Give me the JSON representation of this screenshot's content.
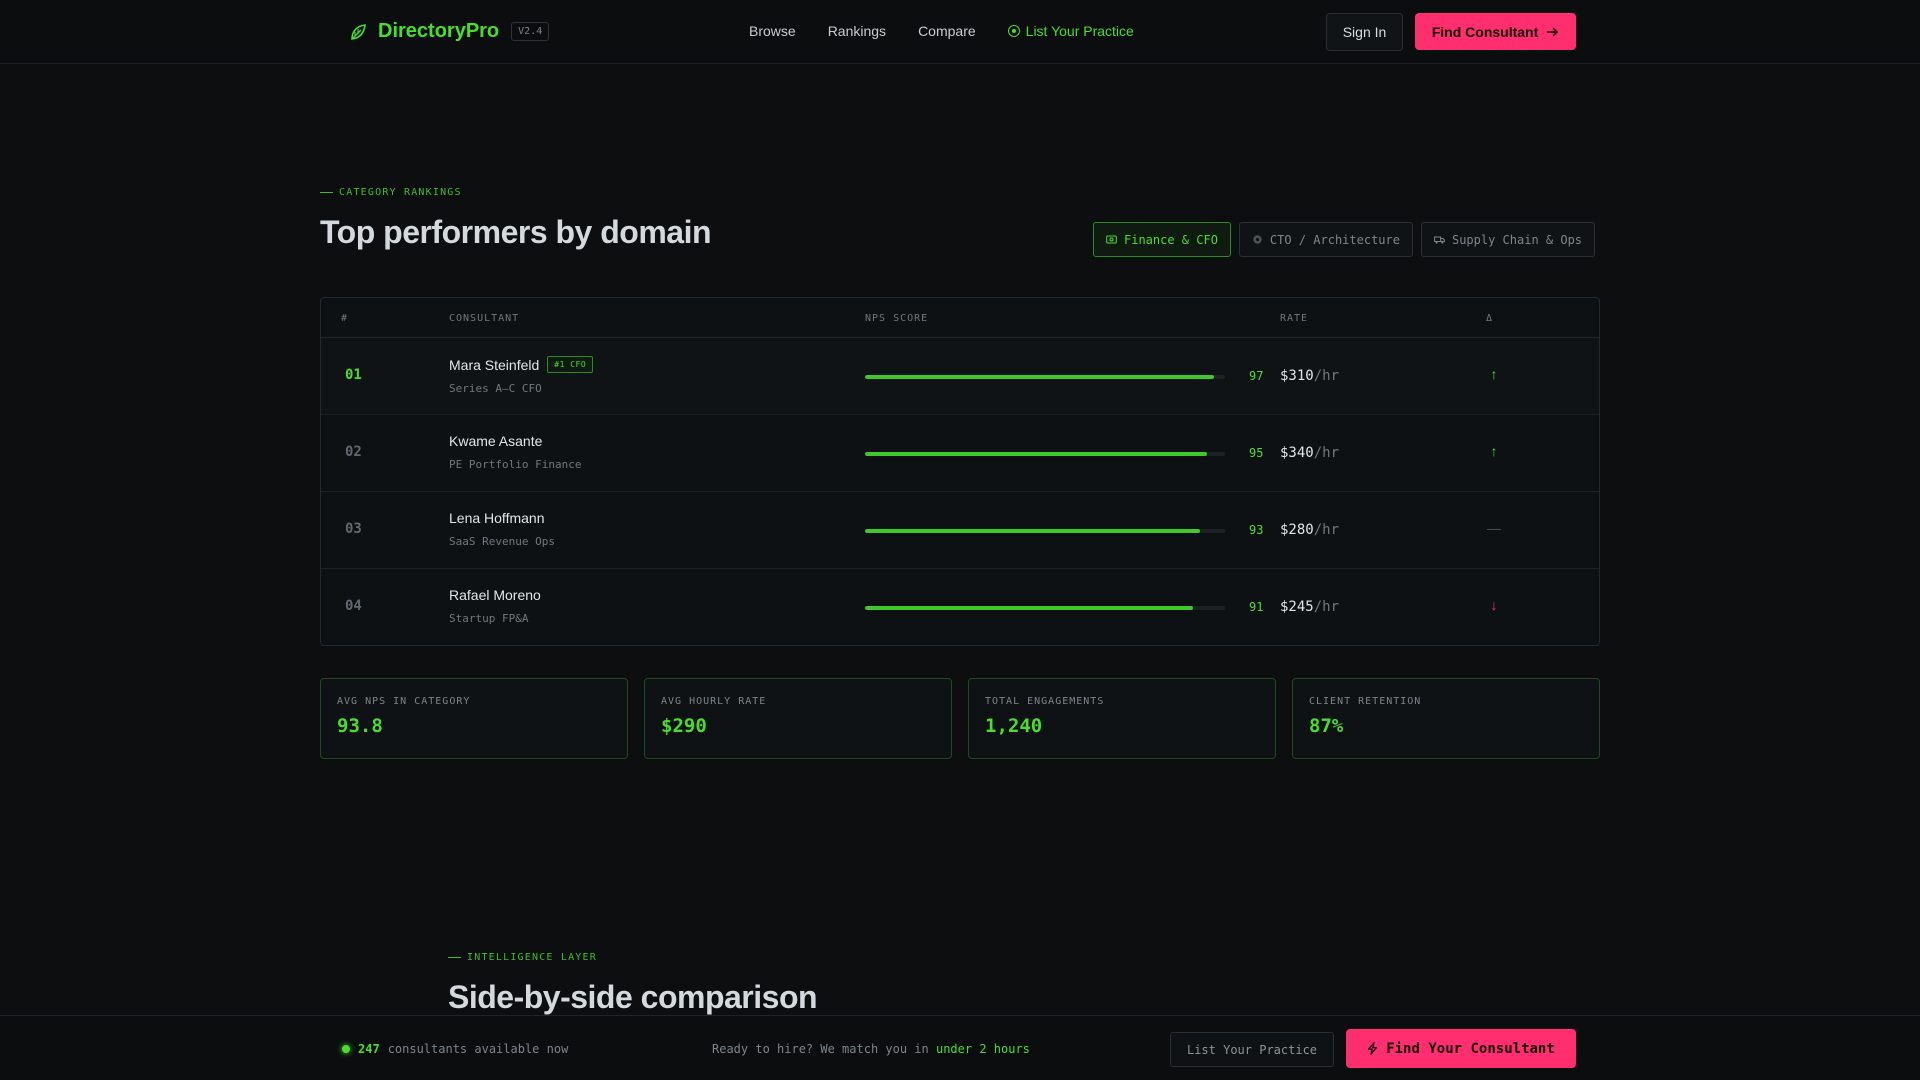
{
  "header": {
    "brand": "DirectoryPro",
    "version": "V2.4",
    "nav": [
      "Browse",
      "Rankings",
      "Compare"
    ],
    "nav_cta": "List Your Practice",
    "sign_in": "Sign In",
    "find_consultant": "Find Consultant"
  },
  "rankings": {
    "eyebrow": "CATEGORY RANKINGS",
    "title": "Top performers by domain",
    "filters": [
      {
        "label": "Finance & CFO",
        "active": true,
        "icon": "card-icon"
      },
      {
        "label": "CTO / Architecture",
        "active": false,
        "icon": "gear-icon"
      },
      {
        "label": "Supply Chain & Ops",
        "active": false,
        "icon": "truck-icon"
      }
    ],
    "columns": {
      "rank": "#",
      "consultant": "CONSULTANT",
      "nps": "NPS SCORE",
      "rate": "RATE",
      "delta": "Δ"
    },
    "rows": [
      {
        "rank": "01",
        "name": "Mara Steinfeld",
        "badge": "#1 CFO",
        "subtitle": "Series A–C CFO",
        "nps": 97,
        "nps_label": "97",
        "rate": "$310",
        "rate_unit": "/hr",
        "trend": "up",
        "trend_glyph": "↑"
      },
      {
        "rank": "02",
        "name": "Kwame Asante",
        "badge": "",
        "subtitle": "PE Portfolio Finance",
        "nps": 95,
        "nps_label": "95",
        "rate": "$340",
        "rate_unit": "/hr",
        "trend": "up",
        "trend_glyph": "↑"
      },
      {
        "rank": "03",
        "name": "Lena Hoffmann",
        "badge": "",
        "subtitle": "SaaS Revenue Ops",
        "nps": 93,
        "nps_label": "93",
        "rate": "$280",
        "rate_unit": "/hr",
        "trend": "flat",
        "trend_glyph": "—"
      },
      {
        "rank": "04",
        "name": "Rafael Moreno",
        "badge": "",
        "subtitle": "Startup FP&A",
        "nps": 91,
        "nps_label": "91",
        "rate": "$245",
        "rate_unit": "/hr",
        "trend": "down",
        "trend_glyph": "↓"
      }
    ],
    "stats": [
      {
        "label": "AVG NPS IN CATEGORY",
        "value": "93.8"
      },
      {
        "label": "AVG HOURLY RATE",
        "value": "$290"
      },
      {
        "label": "TOTAL ENGAGEMENTS",
        "value": "1,240"
      },
      {
        "label": "CLIENT RETENTION",
        "value": "87%"
      }
    ]
  },
  "comparison": {
    "eyebrow": "INTELLIGENCE LAYER",
    "title": "Side-by-side comparison"
  },
  "bottom_bar": {
    "available_count": "247",
    "available_text": "consultants available now",
    "ready_text": "Ready to hire? We match you in",
    "ready_highlight": "under 2 hours",
    "list_practice": "List Your Practice",
    "find_consultant": "Find Your Consultant"
  },
  "colors": {
    "accent_green": "#4ade2c",
    "accent_pink": "#ff2e6e",
    "background": "#0c0e10"
  }
}
